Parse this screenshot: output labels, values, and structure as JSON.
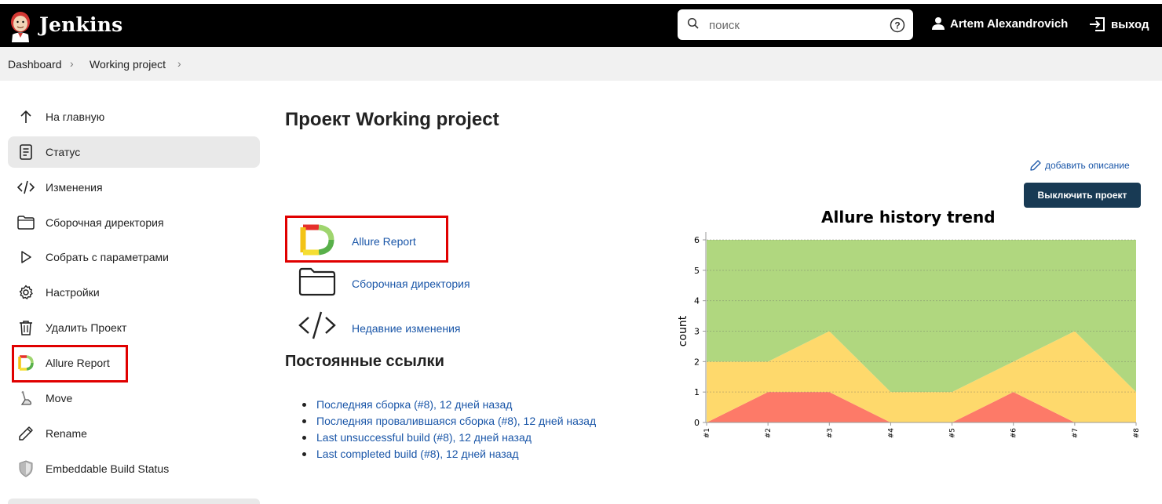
{
  "header": {
    "brand": "Jenkins",
    "search_placeholder": "поиск",
    "user_name": "Artem Alexandrovich",
    "logout_label": "выход"
  },
  "breadcrumb": [
    "Dashboard",
    "Working project"
  ],
  "sidebar": {
    "items": [
      {
        "label": "На главную",
        "icon": "arrow-up-icon"
      },
      {
        "label": "Статус",
        "icon": "document-icon",
        "active": true
      },
      {
        "label": "Изменения",
        "icon": "code-icon"
      },
      {
        "label": "Сборочная директория",
        "icon": "folder-icon"
      },
      {
        "label": "Собрать с параметрами",
        "icon": "play-icon"
      },
      {
        "label": "Настройки",
        "icon": "gear-icon"
      },
      {
        "label": "Удалить Проект",
        "icon": "trash-icon"
      },
      {
        "label": "Allure Report",
        "icon": "allure-icon",
        "highlighted": true
      },
      {
        "label": "Move",
        "icon": "move-icon"
      },
      {
        "label": "Rename",
        "icon": "pencil-icon"
      },
      {
        "label": "Embeddable Build Status",
        "icon": "shield-icon"
      }
    ]
  },
  "main": {
    "title": "Проект Working project",
    "add_description": "добавить описание",
    "disable_button": "Выключить проект",
    "links": [
      {
        "label": "Allure Report",
        "icon": "allure-icon",
        "highlighted": true
      },
      {
        "label": "Сборочная директория",
        "icon": "folder-icon"
      },
      {
        "label": "Недавние изменения",
        "icon": "code-icon"
      }
    ],
    "permalinks_title": "Постоянные ссылки",
    "permalinks": [
      "Последняя сборка (#8), 12 дней назад",
      "Последняя провалившаяся сборка (#8), 12 дней назад",
      "Last unsuccessful build (#8), 12 дней назад",
      "Last completed build (#8), 12 дней назад"
    ]
  },
  "colors": {
    "highlight": "#e00000",
    "link": "#1a56a8",
    "button": "#183a54",
    "passed": "#b0d77f",
    "broken": "#fed96c",
    "failed": "#fd7a68"
  },
  "chart_data": {
    "type": "area",
    "title": "Allure history trend",
    "xlabel": "",
    "ylabel": "count",
    "categories": [
      "#1",
      "#2",
      "#3",
      "#4",
      "#5",
      "#6",
      "#7",
      "#8"
    ],
    "ylim": [
      0,
      6
    ],
    "yticks": [
      0,
      1,
      2,
      3,
      4,
      5,
      6
    ],
    "stacked": true,
    "grid": true,
    "series": [
      {
        "key": "failed",
        "values": [
          0,
          1,
          1,
          0,
          0,
          1,
          0,
          0
        ]
      },
      {
        "key": "broken",
        "values": [
          2,
          1,
          2,
          1,
          1,
          1,
          3,
          1
        ]
      },
      {
        "key": "passed",
        "values": [
          4,
          4,
          3,
          5,
          5,
          4,
          3,
          5
        ]
      }
    ]
  }
}
